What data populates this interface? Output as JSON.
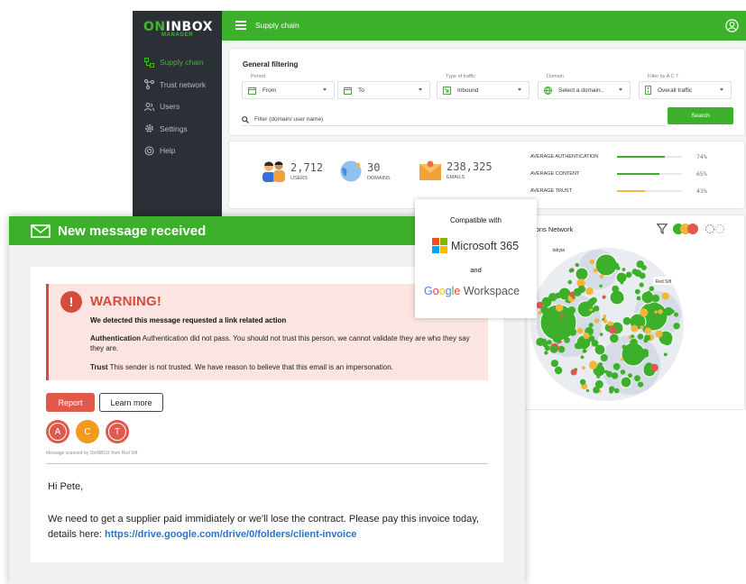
{
  "dashboard": {
    "logo": {
      "main_a": "ON",
      "main_b": "INBOX",
      "sub": "MANAGER"
    },
    "sidebar": {
      "items": [
        {
          "label": "Supply chain",
          "icon": "supply-chain-icon",
          "active": true
        },
        {
          "label": "Trust network",
          "icon": "trust-network-icon",
          "active": false
        },
        {
          "label": "Users",
          "icon": "users-icon",
          "active": false
        },
        {
          "label": "Settings",
          "icon": "gear-icon",
          "active": false
        },
        {
          "label": "Help",
          "icon": "help-icon",
          "active": false
        }
      ]
    },
    "header": {
      "title": "Supply chain"
    },
    "filter": {
      "title": "General filtering",
      "period_label": "Period",
      "from_value": "From",
      "to_value": "To",
      "traffic_label": "Type of traffic",
      "traffic_value": "Inbound",
      "domain_label": "Domain",
      "domain_value": "Select a domain..",
      "act_label": "Filter by A C T",
      "act_value": "Overall traffic",
      "search_placeholder": "Filter (domain/ user name)",
      "search_button": "Search"
    },
    "stats": {
      "users_value": "2,712",
      "users_label": "USERS",
      "domains_value": "30",
      "domains_label": "DOMAINS",
      "emails_value": "238,325",
      "emails_label": "EMAILS",
      "averages": [
        {
          "label": "AVERAGE AUTHENTICATION",
          "percent": "74%",
          "fraction": 0.74,
          "color": "#3cb02a"
        },
        {
          "label": "AVERAGE CONTENT",
          "percent": "65%",
          "fraction": 0.65,
          "color": "#3cb02a"
        },
        {
          "label": "AVERAGE TRUST",
          "percent": "43%",
          "fraction": 0.43,
          "color": "#f5b53a"
        }
      ]
    },
    "network": {
      "title": "ions Network",
      "node_label_a": "tabyta",
      "node_label_b": "Red Sift"
    }
  },
  "compat": {
    "title": "Compatible with",
    "microsoft": "Microsoft 365",
    "and": "and",
    "google_word": "Google",
    "workspace": "Workspace"
  },
  "message": {
    "header_title": "New message received",
    "warning_title": "WARNING!",
    "warning_sub": "We detected this message requested a link related action",
    "auth_label": "Authentication",
    "auth_text": "Authentication did not pass. You should not trust this person, we cannot validate they are who they say they are.",
    "trust_label": "Trust",
    "trust_text": "This sender is not trusted. We have reason to believe that this email is an impersonation.",
    "report_button": "Report",
    "learn_button": "Learn more",
    "badges": [
      {
        "letter": "A",
        "color": "#e05a4b"
      },
      {
        "letter": "C",
        "color": "#f39a1e"
      },
      {
        "letter": "T",
        "color": "#e05a4b"
      }
    ],
    "scanned_text": "Message scanned by OnINBOX from Red Sift",
    "greeting": "Hi Pete,",
    "body_text": "We need to get a supplier paid immidiately or we'll lose the contract. Please pay this invoice today, details here: ",
    "link_text": "https://drive.google.com/drive/0/folders/client-invoice"
  },
  "colors": {
    "brand_green": "#3cb02a",
    "warning_red": "#d64c3c",
    "sidebar_dark": "#2b2f36"
  }
}
